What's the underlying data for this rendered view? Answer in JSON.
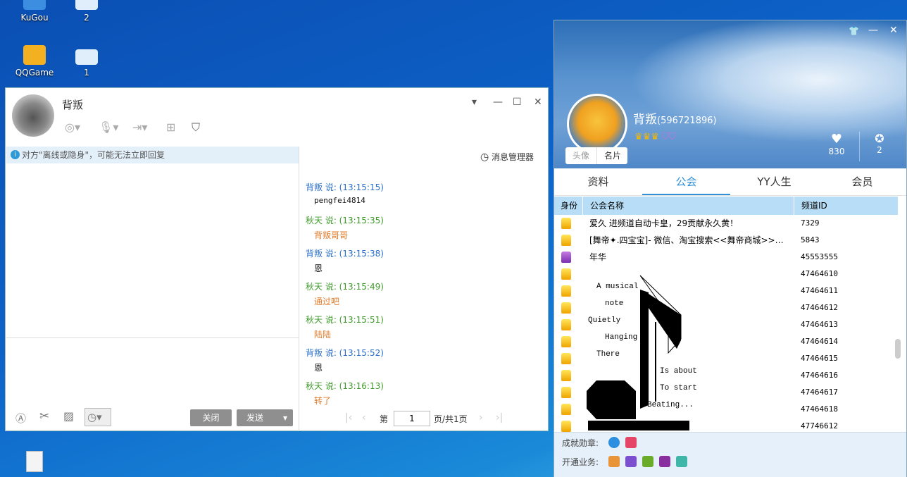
{
  "desktop": {
    "icons": [
      {
        "label": "KuGou"
      },
      {
        "label": "2"
      },
      {
        "label": "QQGame"
      },
      {
        "label": "1"
      }
    ]
  },
  "chat": {
    "contact_name": "背叛",
    "notice": "对方\"离线或隐身\"，可能无法立即回复",
    "message_manager": "消息管理器",
    "messages": [
      {
        "header": "背叛 说: (13:15:15)",
        "body": "pengfei4814",
        "color": "#2a6fc7"
      },
      {
        "header": "秋天 说: (13:15:35)",
        "body": "背叛哥哥",
        "color": "#3f9a2b"
      },
      {
        "header": "背叛 说: (13:15:38)",
        "body": "恩",
        "color": "#2a6fc7"
      },
      {
        "header": "秋天 说: (13:15:49)",
        "body": "通过吧",
        "color": "#3f9a2b"
      },
      {
        "header": "秋天 说: (13:15:51)",
        "body": "陆陆",
        "color": "#3f9a2b"
      },
      {
        "header": "背叛 说: (13:15:52)",
        "body": "恩",
        "color": "#2a6fc7"
      },
      {
        "header": "秋天 说: (13:16:13)",
        "body": "转了",
        "color": "#3f9a2b"
      }
    ],
    "close_label": "关闭",
    "send_label": "发送",
    "pager": {
      "prefix": "第",
      "page": "1",
      "suffix": "页/共1页"
    }
  },
  "profile": {
    "name": "背叛",
    "uid": "(596721896)",
    "avatar_tabs": [
      "头像",
      "名片"
    ],
    "likes": "830",
    "medals": "2",
    "tabs": [
      "资料",
      "公会",
      "YY人生",
      "会员"
    ],
    "active_tab": 1,
    "columns": [
      "身份",
      "公会名称",
      "频道ID"
    ],
    "guilds": [
      {
        "name": "爱久    进频道自动卡皇，29贡献永久黄！",
        "id": "7329",
        "role": "gold"
      },
      {
        "name": "[舞帝✦.四宝宝]-  微信、淘宝搜索<<舞帝商城>>…",
        "id": "5843",
        "role": "gold"
      },
      {
        "name": "年华",
        "id": "45553555",
        "role": "purple"
      },
      {
        "name": "",
        "id": "47464610",
        "role": "gold"
      },
      {
        "name": "",
        "id": "47464611",
        "role": "gold"
      },
      {
        "name": "",
        "id": "47464612",
        "role": "gold"
      },
      {
        "name": "",
        "id": "47464613",
        "role": "gold"
      },
      {
        "name": "",
        "id": "47464614",
        "role": "gold"
      },
      {
        "name": "",
        "id": "47464615",
        "role": "gold"
      },
      {
        "name": "",
        "id": "47464616",
        "role": "gold"
      },
      {
        "name": "",
        "id": "47464617",
        "role": "gold"
      },
      {
        "name": "",
        "id": "47464618",
        "role": "gold"
      },
      {
        "name": "",
        "id": "47746612",
        "role": "gold"
      }
    ],
    "art_text": [
      "A musical",
      "note",
      "Quietly",
      "Hanging",
      "There",
      "Is about",
      "To start",
      "Beating..."
    ],
    "achievements_label": "成就勋章:",
    "services_label": "开通业务:"
  }
}
